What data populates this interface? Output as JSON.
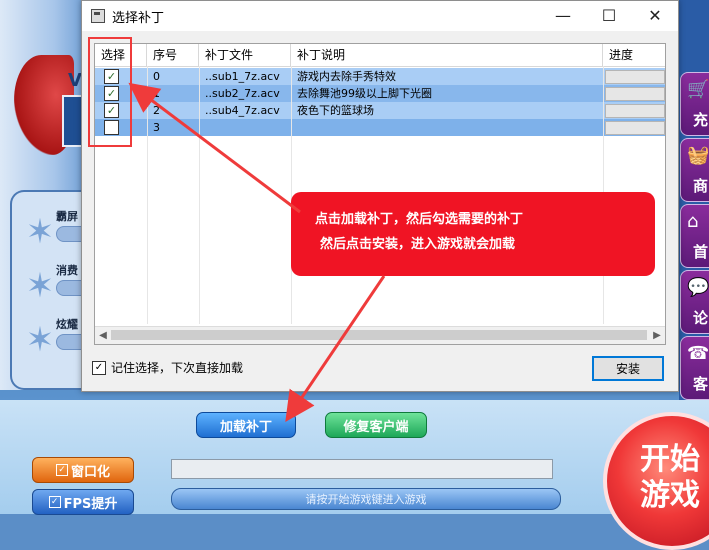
{
  "launcher": {
    "logo_letter": "V",
    "side_buttons": [
      {
        "label": "霸屏"
      },
      {
        "label": "消费"
      },
      {
        "label": "炫耀"
      }
    ],
    "right_menu": [
      {
        "icon": "cart-icon",
        "label": "充"
      },
      {
        "icon": "basket-icon",
        "label": "商"
      },
      {
        "icon": "home-icon",
        "label": "首"
      },
      {
        "icon": "chat-icon",
        "label": "论"
      },
      {
        "icon": "service-icon",
        "label": "客"
      }
    ],
    "window_mode_label": "窗口化",
    "fps_label": "FPS提升",
    "load_patch_label": "加载补丁",
    "repair_client_label": "修复客户端",
    "status_text": "请按开始游戏键进入游戏",
    "start_label_1": "开始",
    "start_label_2": "游戏"
  },
  "dialog": {
    "title": "选择补丁",
    "columns": [
      "选择",
      "序号",
      "补丁文件",
      "补丁说明",
      "进度"
    ],
    "rows": [
      {
        "checked": true,
        "index": "0",
        "file": "..sub1_7z.acv",
        "desc": "游戏内去除手秀特效"
      },
      {
        "checked": true,
        "index": "1",
        "file": "..sub2_7z.acv",
        "desc": "去除舞池99级以上脚下光圈"
      },
      {
        "checked": true,
        "index": "2",
        "file": "..sub4_7z.acv",
        "desc": "夜色下的篮球场"
      },
      {
        "checked": false,
        "index": "3",
        "file": "",
        "desc": ""
      }
    ],
    "remember_label": "记住选择，下次直接加载",
    "remember_checked": true,
    "install_label": "安装",
    "minimize": "—",
    "maximize": "☐",
    "close": "✕"
  },
  "annotation": {
    "line1": "点击加载补丁，然后勾选需要的补丁",
    "line2": "然后点击安装，进入游戏就会加载",
    "color": "#f01424"
  }
}
